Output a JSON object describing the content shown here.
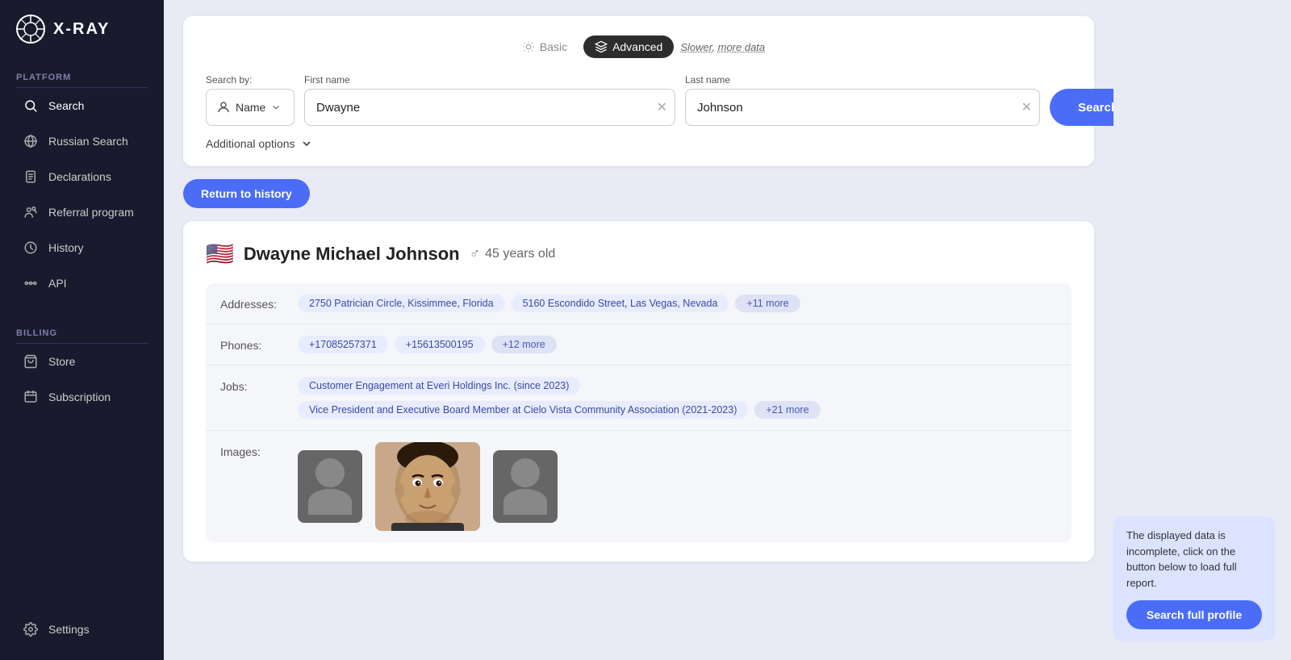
{
  "logo": {
    "text": "X-RAY"
  },
  "sidebar": {
    "platform_label": "Platform",
    "billing_label": "Billing",
    "items": [
      {
        "id": "search",
        "label": "Search",
        "active": true
      },
      {
        "id": "russian-search",
        "label": "Russian Search",
        "active": false
      },
      {
        "id": "declarations",
        "label": "Declarations",
        "active": false
      },
      {
        "id": "referral",
        "label": "Referral program",
        "active": false
      },
      {
        "id": "history",
        "label": "History",
        "active": false
      },
      {
        "id": "api",
        "label": "API",
        "active": false
      }
    ],
    "billing_items": [
      {
        "id": "store",
        "label": "Store",
        "active": false
      },
      {
        "id": "subscription",
        "label": "Subscription",
        "active": false
      }
    ],
    "settings_label": "Settings"
  },
  "search_card": {
    "basic_label": "Basic",
    "advanced_label": "Advanced",
    "slower_label": "Slower,",
    "more_data_label": "more data",
    "search_by_label": "Search by:",
    "name_select_label": "Name",
    "first_name_label": "First name",
    "first_name_value": "Dwayne",
    "last_name_label": "Last name",
    "last_name_value": "Johnson",
    "search_button_label": "Search",
    "additional_options_label": "Additional options"
  },
  "return_btn": {
    "label": "Return to history"
  },
  "result": {
    "flag": "🇺🇸",
    "name": "Dwayne Michael Johnson",
    "gender": "♂",
    "age": "45 years old",
    "addresses_label": "Addresses:",
    "addresses": [
      "2750 Patrician Circle, Kissimmee, Florida",
      "5160 Escondido Street, Las Vegas, Nevada",
      "+11 more"
    ],
    "phones_label": "Phones:",
    "phones": [
      "+17085257371",
      "+15613500195",
      "+12 more"
    ],
    "jobs_label": "Jobs:",
    "jobs": [
      "Customer Engagement at Everi Holdings Inc. (since 2023)",
      "Vice President and Executive Board Member at Cielo Vista Community Association (2021-2023)",
      "+21 more"
    ],
    "images_label": "Images:"
  },
  "tooltip": {
    "text": "The displayed data is incomplete, click on the button below to load full report.",
    "button_label": "Search full profile"
  }
}
